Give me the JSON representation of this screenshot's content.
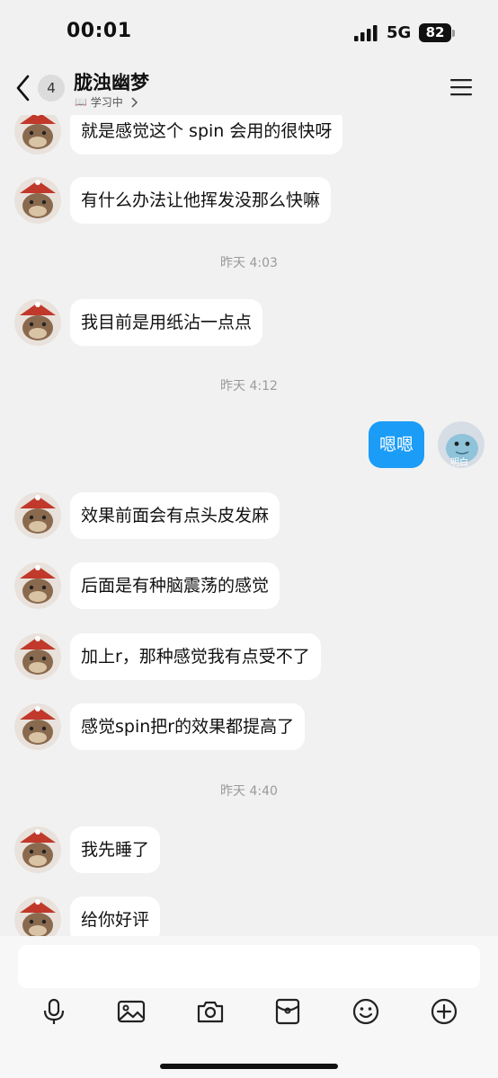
{
  "status_bar": {
    "time": "00:01",
    "network": "5G",
    "battery": "82"
  },
  "header": {
    "back_badge": "4",
    "contact_name": "胧浊幽梦",
    "contact_status": "学习中",
    "book_icon": "📖"
  },
  "messages": [
    {
      "side": "left",
      "text": "就是感觉这个 spin 会用的很快呀"
    },
    {
      "side": "left",
      "text": "有什么办法让他挥发没那么快嘛"
    },
    {
      "type": "time",
      "text": "昨天 4:03"
    },
    {
      "side": "left",
      "text": "我目前是用纸沾一点点"
    },
    {
      "type": "time",
      "text": "昨天 4:12"
    },
    {
      "side": "right",
      "text": "嗯嗯",
      "avatar_label": "明白"
    },
    {
      "side": "left",
      "text": "效果前面会有点头皮发麻"
    },
    {
      "side": "left",
      "text": "后面是有种脑震荡的感觉"
    },
    {
      "side": "left",
      "text": "加上r，那种感觉我有点受不了"
    },
    {
      "side": "left",
      "text": "感觉spin把r的效果都提高了"
    },
    {
      "type": "time",
      "text": "昨天 4:40"
    },
    {
      "side": "left",
      "text": "我先睡了"
    },
    {
      "side": "left",
      "text": "给你好评"
    }
  ],
  "input": {
    "placeholder": ""
  },
  "toolbar": [
    "microphone-icon",
    "image-icon",
    "camera-icon",
    "red-packet-icon",
    "emoji-icon",
    "plus-icon"
  ],
  "colors": {
    "accent": "#1a9cf7",
    "background": "#f1f1f1",
    "bubble": "#ffffff"
  }
}
